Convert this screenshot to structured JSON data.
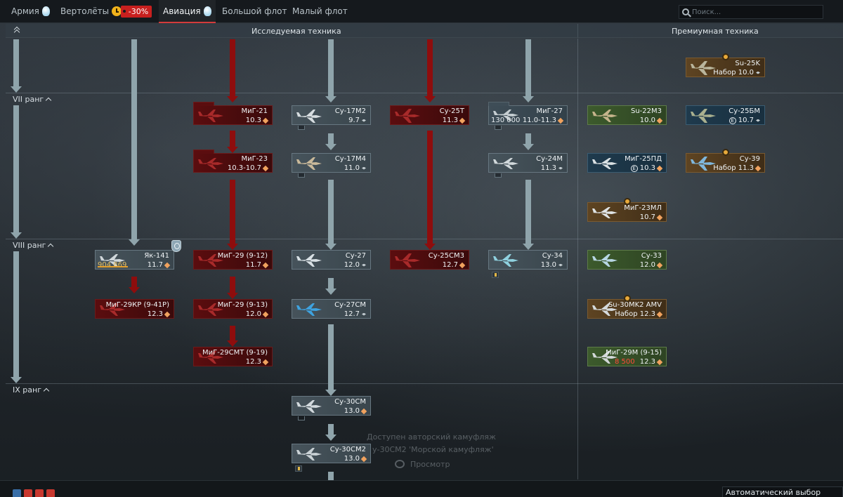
{
  "tabs": [
    {
      "label": "Армия",
      "icon": "lightbulb-icon"
    },
    {
      "label": "Вертолёты",
      "icon": "clock-icon",
      "discount": "-30%"
    },
    {
      "label": "Авиация",
      "icon": "lightbulb-icon",
      "active": true
    },
    {
      "label": "Большой флот"
    },
    {
      "label": "Малый флот"
    }
  ],
  "search": {
    "placeholder": "Поиск..."
  },
  "header": {
    "researched_title": "Исследуемая техника",
    "premium_title": "Премиумная техника"
  },
  "ranks": [
    "VII ранг",
    "VIII ранг",
    "IX ранг"
  ],
  "vehicles": {
    "mig21": {
      "name": "МиГ-21",
      "br": "10.3"
    },
    "su17m2": {
      "name": "Су-17М2",
      "br": "9.7"
    },
    "su25t": {
      "name": "Су-25Т",
      "br": "11.3"
    },
    "mig27": {
      "name": "МиГ-27",
      "br": "11.0-11.3",
      "rp": "130 000"
    },
    "mig23": {
      "name": "МиГ-23",
      "br": "10.3-10.7"
    },
    "su17m4": {
      "name": "Су-17М4",
      "br": "11.0"
    },
    "su24m": {
      "name": "Су-24М",
      "br": "11.3"
    },
    "yak141": {
      "name": "Як-141",
      "br": "11.7",
      "rp": "904 869"
    },
    "mig29_912": {
      "name": "МиГ-29 (9-12)",
      "br": "11.7"
    },
    "su27": {
      "name": "Су-27",
      "br": "12.0"
    },
    "su25sm3": {
      "name": "Су-25СМ3",
      "br": "12.7"
    },
    "su34": {
      "name": "Су-34",
      "br": "13.0"
    },
    "mig29kr": {
      "name": "МиГ-29КР (9-41Р)",
      "br": "12.3"
    },
    "mig29_913": {
      "name": "МиГ-29 (9-13)",
      "br": "12.0"
    },
    "su27sm": {
      "name": "Су-27СМ",
      "br": "12.7"
    },
    "mig29smt": {
      "name": "МиГ-29СМТ (9-19)",
      "br": "12.3"
    },
    "su30sm": {
      "name": "Су-30СМ",
      "br": "13.0"
    },
    "su30sm2": {
      "name": "Су-30СМ2",
      "br": "13.0"
    },
    "su25k": {
      "name": "Su-25K",
      "br": "Набор 10.0"
    },
    "su22m3": {
      "name": "Su-22M3",
      "br": "10.0"
    },
    "su25bm": {
      "name": "Су-25БМ",
      "br": "10.7"
    },
    "mig25pd": {
      "name": "МиГ-25ПД",
      "br": "10.3"
    },
    "su39": {
      "name": "Су-39",
      "br": "Набор 11.3"
    },
    "mig23ml": {
      "name": "МиГ-23МЛ",
      "br": "10.7"
    },
    "su33": {
      "name": "Су-33",
      "br": "12.0"
    },
    "su30mk2": {
      "name": "Su-30MK2 AMV",
      "br": "Набор 12.3"
    },
    "mig29m": {
      "name": "МиГ-29М (9-15)",
      "br": "12.3",
      "price": "8 500"
    }
  },
  "hint": {
    "line1": "Доступен авторский камуфляж",
    "line2": "у-30СМ2 'Морской камуфляж'",
    "line3": "Просмотр"
  },
  "bottom": {
    "select_value": "Автоматический выбор"
  },
  "colors": {
    "accent_red": "#d33b3b",
    "researched_red": "#5b0d0f",
    "premium_green": "#3c5a2c",
    "premium_blue": "#1f3a4d",
    "premium_brown": "#5e4422",
    "br_diamond": "#f0a25e"
  }
}
